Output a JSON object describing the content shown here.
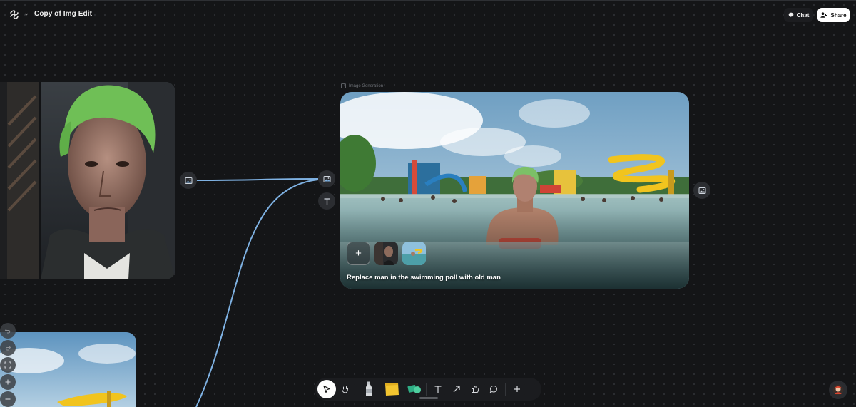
{
  "header": {
    "title": "Copy of Img Edit",
    "chat_label": "Chat",
    "share_label": "Share"
  },
  "generation_node": {
    "label": "Image Generation",
    "prompt": "Replace man in the swimming poll with old man",
    "add_symbol": "+"
  },
  "icons": {
    "logo": "app-logo-icon",
    "chevron": "chevron-down-icon",
    "chat": "chat-bubble-icon",
    "share": "people-icon",
    "image_port": "image-icon",
    "text_port": "text-icon"
  },
  "toolbar": {
    "tools": [
      "select",
      "hand",
      "bottle",
      "sticky-note",
      "shapes",
      "text",
      "arrow",
      "thumbs-up",
      "comment",
      "add"
    ],
    "active_tool": "select"
  },
  "colors": {
    "canvas": "#141517",
    "wire": "#7fb2e3",
    "share_button": "#ffffff"
  }
}
